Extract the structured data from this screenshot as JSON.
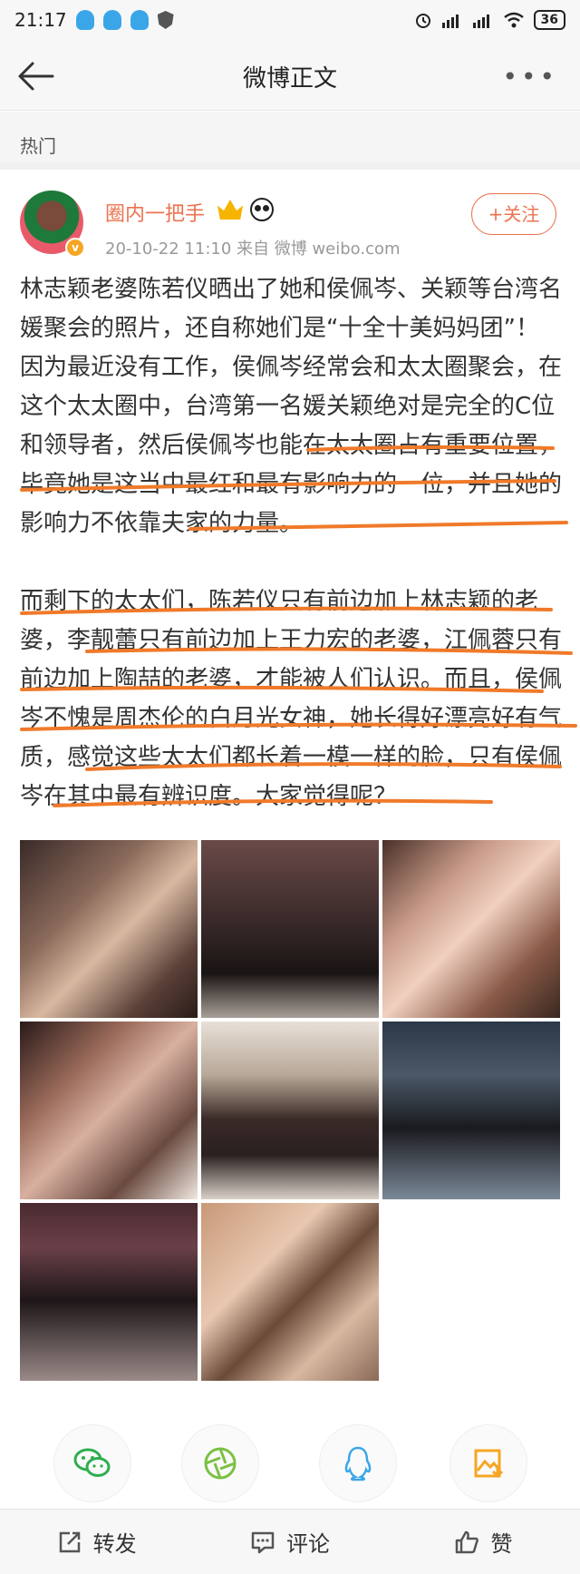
{
  "status_bar": {
    "time": "21:17",
    "battery": "36"
  },
  "nav": {
    "title": "微博正文"
  },
  "section": {
    "label": "热门"
  },
  "author": {
    "name": "圈内一把手",
    "meta": "20-10-22 11:10  来自 微博 weibo.com",
    "follow_label": "+关注"
  },
  "post": {
    "paragraph1": "林志颖老婆陈若仪晒出了她和侯佩岑、关颖等台湾名媛聚会的照片，还自称她们是“十全十美妈妈团”！因为最近没有工作，侯佩岑经常会和太太圈聚会，在这个太太圈中，台湾第一名媛关颖绝对是完全的C位和领导者，然后侯佩岑也能在太太圈占有重要位置，毕竟她是这当中最红和最有影响力的一位，并且她的影响力不依靠夫家的力量。",
    "paragraph2": "而剩下的太太们，陈若仪只有前边加上林志颖的老婆，李靓蕾只有前边加上王力宏的老婆，江佩蓉只有前边加上陶喆的老婆，才能被人们认识。而且，侯佩岑不愧是周杰伦的白月光女神，她长得好漂亮好有气质，感觉这些太太们都长着一模一样的脸，只有侯佩岑在其中最有辨识度。大家觉得呢？"
  },
  "photos": [
    {
      "caption": ""
    },
    {
      "caption": ""
    },
    {
      "caption": ""
    },
    {
      "caption": ""
    },
    {
      "caption": ""
    },
    {
      "caption": ""
    },
    {
      "caption": ""
    },
    {
      "caption": ""
    }
  ],
  "share_targets": [
    "wechat-icon",
    "moments-icon",
    "qq-icon",
    "save-image-icon"
  ],
  "actions": {
    "repost": "转发",
    "comment": "评论",
    "like": "赞"
  },
  "colors": {
    "accent": "#eb7350",
    "underline": "#f07a2a"
  }
}
